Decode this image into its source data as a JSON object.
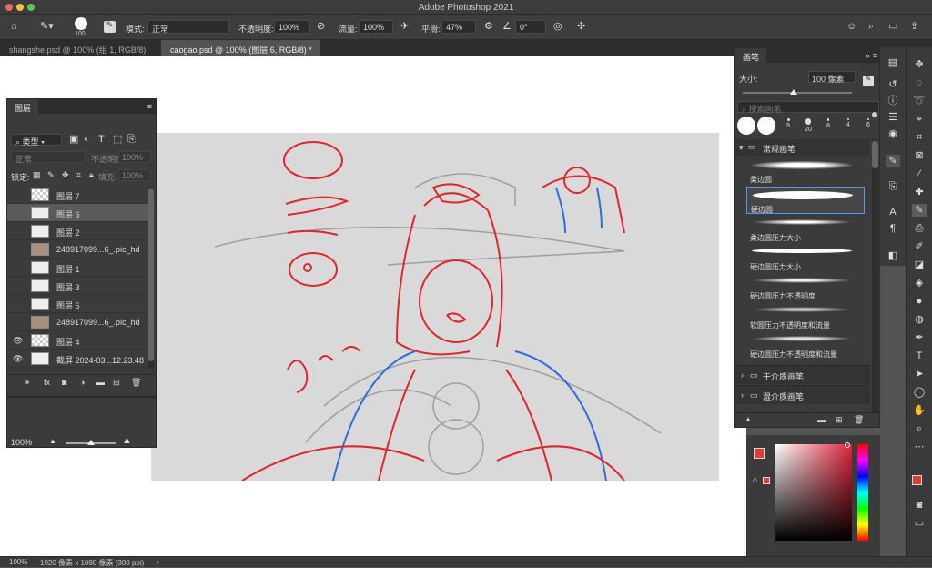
{
  "app": {
    "title": "Adobe Photoshop 2021"
  },
  "options": {
    "brush_size": "100",
    "mode_label": "模式:",
    "mode_value": "正常",
    "opacity_label": "不透明度:",
    "opacity_value": "100%",
    "flow_label": "流量:",
    "flow_value": "100%",
    "smooth_label": "平滑:",
    "smooth_value": "47%",
    "angle_value": "0°"
  },
  "tabs": [
    {
      "label": "shangshe.psd @ 100% (组 1, RGB/8)"
    },
    {
      "label": "caogao.psd @ 100% (图层 6, RGB/8) *"
    }
  ],
  "layers_panel": {
    "title": "图层",
    "filter_kind": "类型",
    "blend_mode": "正常",
    "opacity_label": "不透明度:",
    "opacity_value": "100%",
    "lock_label": "锁定:",
    "fill_label": "填充:",
    "fill_value": "100%",
    "layers": [
      {
        "name": "图层 7",
        "visible": false,
        "thumb": "check"
      },
      {
        "name": "图层 6",
        "visible": false,
        "thumb": "white",
        "selected": true
      },
      {
        "name": "图层 2",
        "visible": false,
        "thumb": "white"
      },
      {
        "name": "248917099...6_.pic_hd",
        "visible": false,
        "thumb": "img"
      },
      {
        "name": "图层 1",
        "visible": false,
        "thumb": "white"
      },
      {
        "name": "图层 3",
        "visible": false,
        "thumb": "white"
      },
      {
        "name": "图层 5",
        "visible": false,
        "thumb": "white"
      },
      {
        "name": "248917099...6_.pic_hd",
        "visible": false,
        "thumb": "img"
      },
      {
        "name": "图层 4",
        "visible": true,
        "thumb": "check"
      },
      {
        "name": "截屏 2024-03...12.23.48",
        "visible": true,
        "thumb": "white"
      }
    ]
  },
  "navigator": {
    "zoom": "100%"
  },
  "brushes_panel": {
    "title": "画笔",
    "size_label": "大小:",
    "size_value": "100 像素",
    "search_placeholder": "搜索画笔",
    "preset_sizes": [
      "9",
      "20",
      "8",
      "4",
      "6"
    ],
    "group_title": "常规画笔",
    "brushes": [
      {
        "name": "柔边圆"
      },
      {
        "name": "硬边圆",
        "selected": true
      },
      {
        "name": "柔边圆压力大小"
      },
      {
        "name": "硬边圆压力大小"
      },
      {
        "name": "硬边圆压力不透明度"
      },
      {
        "name": "软圆压力不透明度和流量"
      },
      {
        "name": "硬边圆压力不透明度和流量"
      }
    ],
    "folders": [
      {
        "name": "干介质画笔"
      },
      {
        "name": "湿介质画笔"
      }
    ]
  },
  "colors": {
    "foreground": "#e53935",
    "background": "#111111"
  },
  "status": {
    "zoom": "100%",
    "doc_info": "1920 像素 x 1080 像素 (300 ppi)"
  }
}
